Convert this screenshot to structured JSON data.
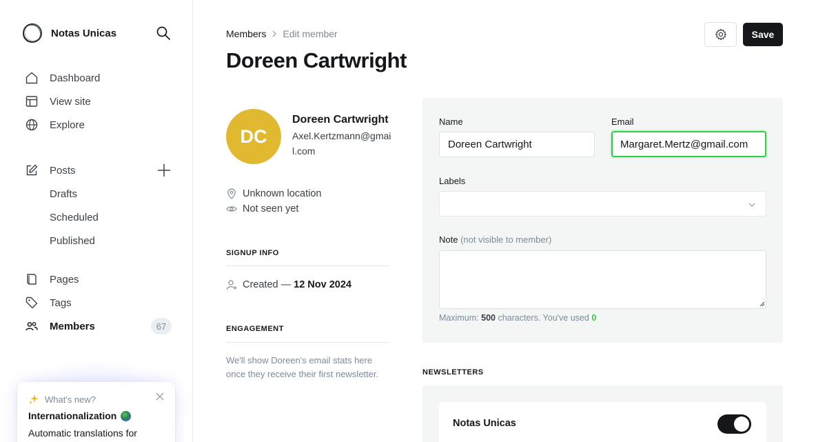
{
  "sidebar": {
    "brand": "Notas Unicas",
    "nav": [
      {
        "label": "Dashboard",
        "icon": "home-icon"
      },
      {
        "label": "View site",
        "icon": "layout-icon"
      },
      {
        "label": "Explore",
        "icon": "globe-icon"
      }
    ],
    "posts": {
      "label": "Posts",
      "icon": "edit-icon"
    },
    "post_subitems": [
      "Drafts",
      "Scheduled",
      "Published"
    ],
    "pages": {
      "label": "Pages",
      "icon": "page-icon"
    },
    "tags": {
      "label": "Tags",
      "icon": "tag-icon"
    },
    "members": {
      "label": "Members",
      "icon": "members-icon",
      "count": "67"
    },
    "whats_new": {
      "header": "What's new?",
      "title": "Internationalization",
      "text": "Automatic translations for"
    }
  },
  "header": {
    "breadcrumb_parent": "Members",
    "breadcrumb_current": "Edit member",
    "title": "Doreen Cartwright",
    "save_label": "Save"
  },
  "member": {
    "initials": "DC",
    "name": "Doreen Cartwright",
    "email": "Axel.Kertzmann@gmail.com",
    "location": "Unknown location",
    "seen": "Not seen yet",
    "avatar_color": "#e1b931"
  },
  "signup": {
    "heading": "SIGNUP INFO",
    "created_label": "Created —",
    "created_date": "12 Nov 2024"
  },
  "engagement": {
    "heading": "ENGAGEMENT",
    "text": "We'll show Doreen's email stats here once they receive their first newsletter."
  },
  "form": {
    "name_label": "Name",
    "name_value": "Doreen Cartwright",
    "email_label": "Email",
    "email_value": "Margaret.Mertz@gmail.com",
    "labels_label": "Labels",
    "note_label": "Note",
    "note_hint": "(not visible to member)",
    "note_value": "",
    "max_prefix": "Maximum:",
    "max_chars": "500",
    "max_middle": "characters. You've used",
    "used_chars": "0"
  },
  "newsletters": {
    "heading": "NEWSLETTERS",
    "items": [
      {
        "name": "Notas Unicas",
        "subscribed": true
      }
    ]
  },
  "colors": {
    "accent_green": "#30cf43",
    "dark": "#15171a"
  }
}
